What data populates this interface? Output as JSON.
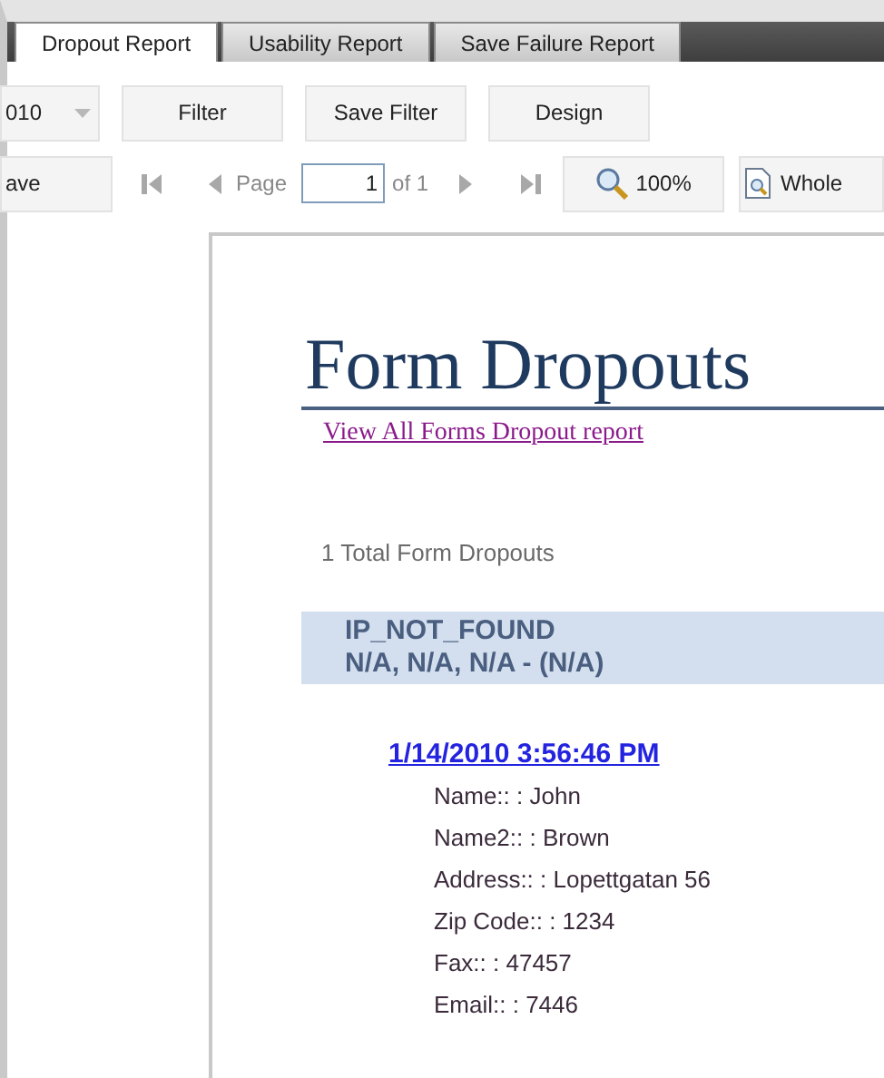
{
  "tabs": [
    {
      "label": "Dropout Report",
      "selected": true
    },
    {
      "label": "Usability Report",
      "selected": false
    },
    {
      "label": "Save Failure Report",
      "selected": false
    }
  ],
  "toolbar": {
    "year_dropdown": {
      "value": "010"
    },
    "buttons": [
      "Filter",
      "Save Filter",
      "Design"
    ]
  },
  "pager": {
    "save_button": "ave",
    "page_label": "Page",
    "page_value": "1",
    "page_of": "of 1",
    "zoom_button": "100%",
    "whole_button": "Whole"
  },
  "report": {
    "title": "Form Dropouts",
    "link": "View All Forms Dropout report",
    "total": "1 Total Form Dropouts",
    "group": {
      "line_1": "IP_NOT_FOUND",
      "line_2": "N/A, N/A, N/A - (N/A)"
    },
    "entries": [
      {
        "date": "1/14/2010 3:56:46 PM",
        "fields": [
          "Name:: : John",
          "Name2:: : Brown",
          "Address:: : Lopettgatan 56",
          "Zip Code:: : 1234",
          "Fax:: : 47457",
          "Email:: : 7446"
        ]
      }
    ]
  }
}
